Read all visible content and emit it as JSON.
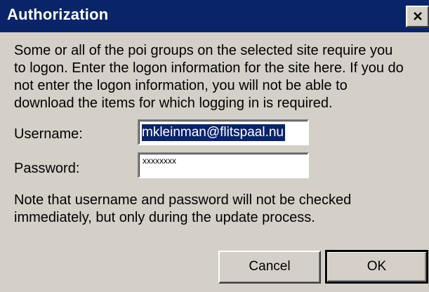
{
  "window": {
    "title": "Authorization",
    "close_label": "Close"
  },
  "message": {
    "lines": [
      "Some or all of the poi groups on the selected site require you",
      "to logon. Enter the logon information for the site here. If you do",
      "not enter the logon information, you will not be able to",
      "download the items for which logging in is required."
    ]
  },
  "form": {
    "username_label": "Username:",
    "username_value": "mkleinman@flitspaal.nu",
    "password_label": "Password:",
    "password_value": "xxxxxxxx"
  },
  "note": {
    "lines": [
      "Note that username and password will not be checked",
      "immediately, but only during the update process."
    ]
  },
  "buttons": {
    "cancel_label": "Cancel",
    "ok_label": "OK"
  },
  "colors": {
    "titlebar": "#0a246a",
    "dialog_face": "#d4d0c8",
    "selection": "#0a246a"
  }
}
